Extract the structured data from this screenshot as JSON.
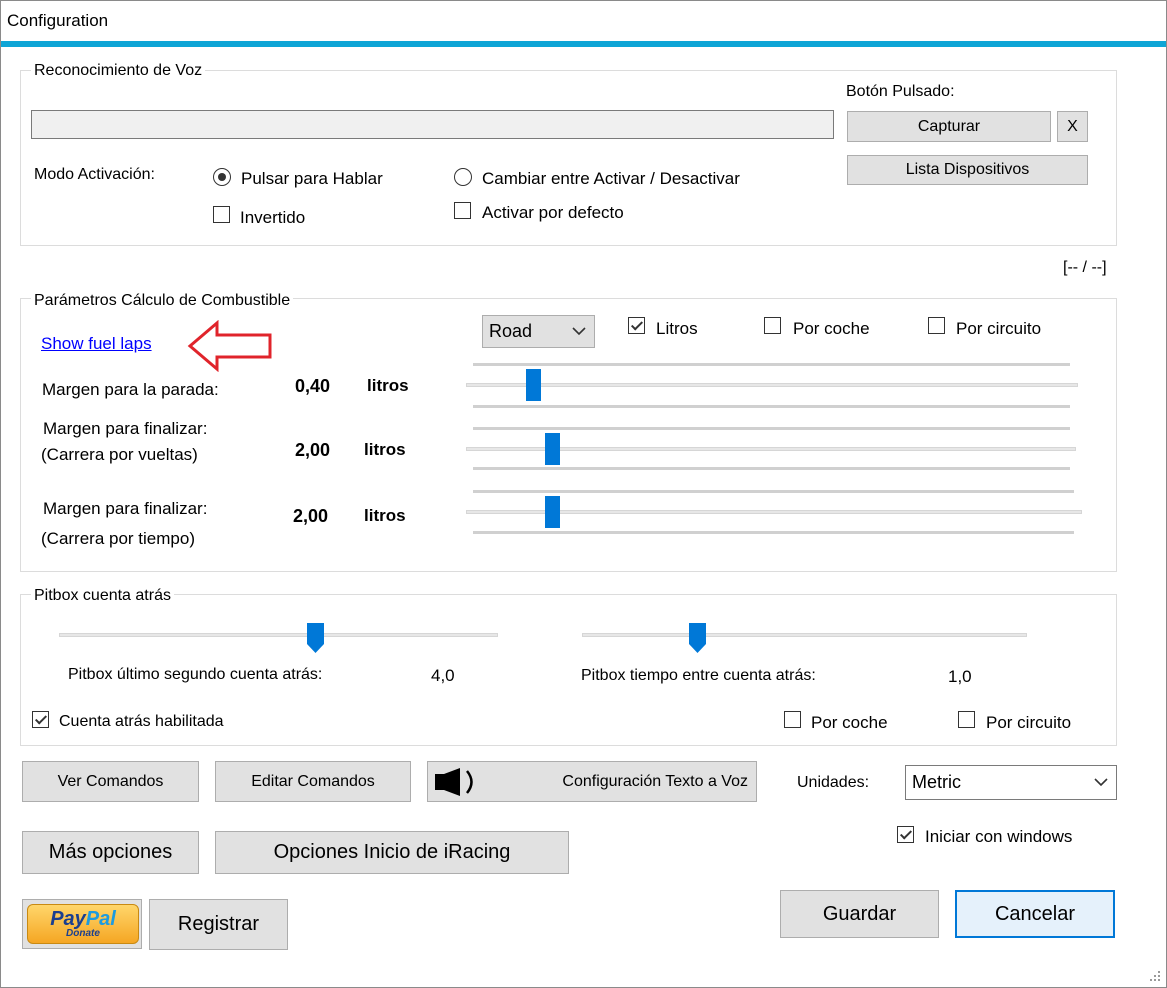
{
  "window": {
    "title": "Configuration",
    "accent_color": "#0ea5d6"
  },
  "voice": {
    "group_title": "Reconocimiento de Voz",
    "boton_pulsado_label": "Botón Pulsado:",
    "capturar_label": "Capturar",
    "clear_label": "X",
    "lista_label": "Lista Dispositivos",
    "modo_label": "Modo Activación:",
    "pulsar_label": "Pulsar para Hablar",
    "cambiar_label": "Cambiar entre Activar / Desactivar",
    "invertido_label": "Invertido",
    "activar_label": "Activar por defecto",
    "status_text": "[-- / --]"
  },
  "fuel": {
    "group_title": "Parámetros Cálculo de Combustible",
    "show_link": "Show fuel laps",
    "track_type": "Road",
    "litros_label": "Litros",
    "por_coche_label": "Por coche",
    "por_circuito_label": "Por circuito",
    "margen_parada_label": "Margen para la parada:",
    "margen_parada_value": "0,40",
    "margen_parada_unit": "litros",
    "margen_fin_vueltas_label1": "Margen para finalizar:",
    "margen_fin_vueltas_label2": "(Carrera por vueltas)",
    "margen_fin_vueltas_value": "2,00",
    "margen_fin_vueltas_unit": "litros",
    "margen_fin_tiempo_label1": "Margen para finalizar:",
    "margen_fin_tiempo_label2": "(Carrera por tiempo)",
    "margen_fin_tiempo_value": "2,00",
    "margen_fin_tiempo_unit": "litros",
    "arrow_color": "#e0242b"
  },
  "pitbox": {
    "group_title": "Pitbox cuenta atrás",
    "ultimo_label": "Pitbox último segundo cuenta atrás:",
    "ultimo_value": "4,0",
    "entre_label": "Pitbox tiempo entre cuenta atrás:",
    "entre_value": "1,0",
    "habilitada_label": "Cuenta atrás habilitada",
    "por_coche_label": "Por coche",
    "por_circuito_label": "Por circuito"
  },
  "buttons": {
    "ver_comandos": "Ver Comandos",
    "editar_comandos": "Editar Comandos",
    "texto_voz": "Configuración Texto a Voz",
    "unidades_label": "Unidades:",
    "unidades_value": "Metric",
    "mas_opciones": "Más opciones",
    "opciones_iracing": "Opciones Inicio de iRacing",
    "iniciar_windows": "Iniciar con windows",
    "paypal_word1": "Pay",
    "paypal_word2": "Pal",
    "paypal_donate": "Donate",
    "registrar": "Registrar",
    "guardar": "Guardar",
    "cancelar": "Cancelar"
  }
}
